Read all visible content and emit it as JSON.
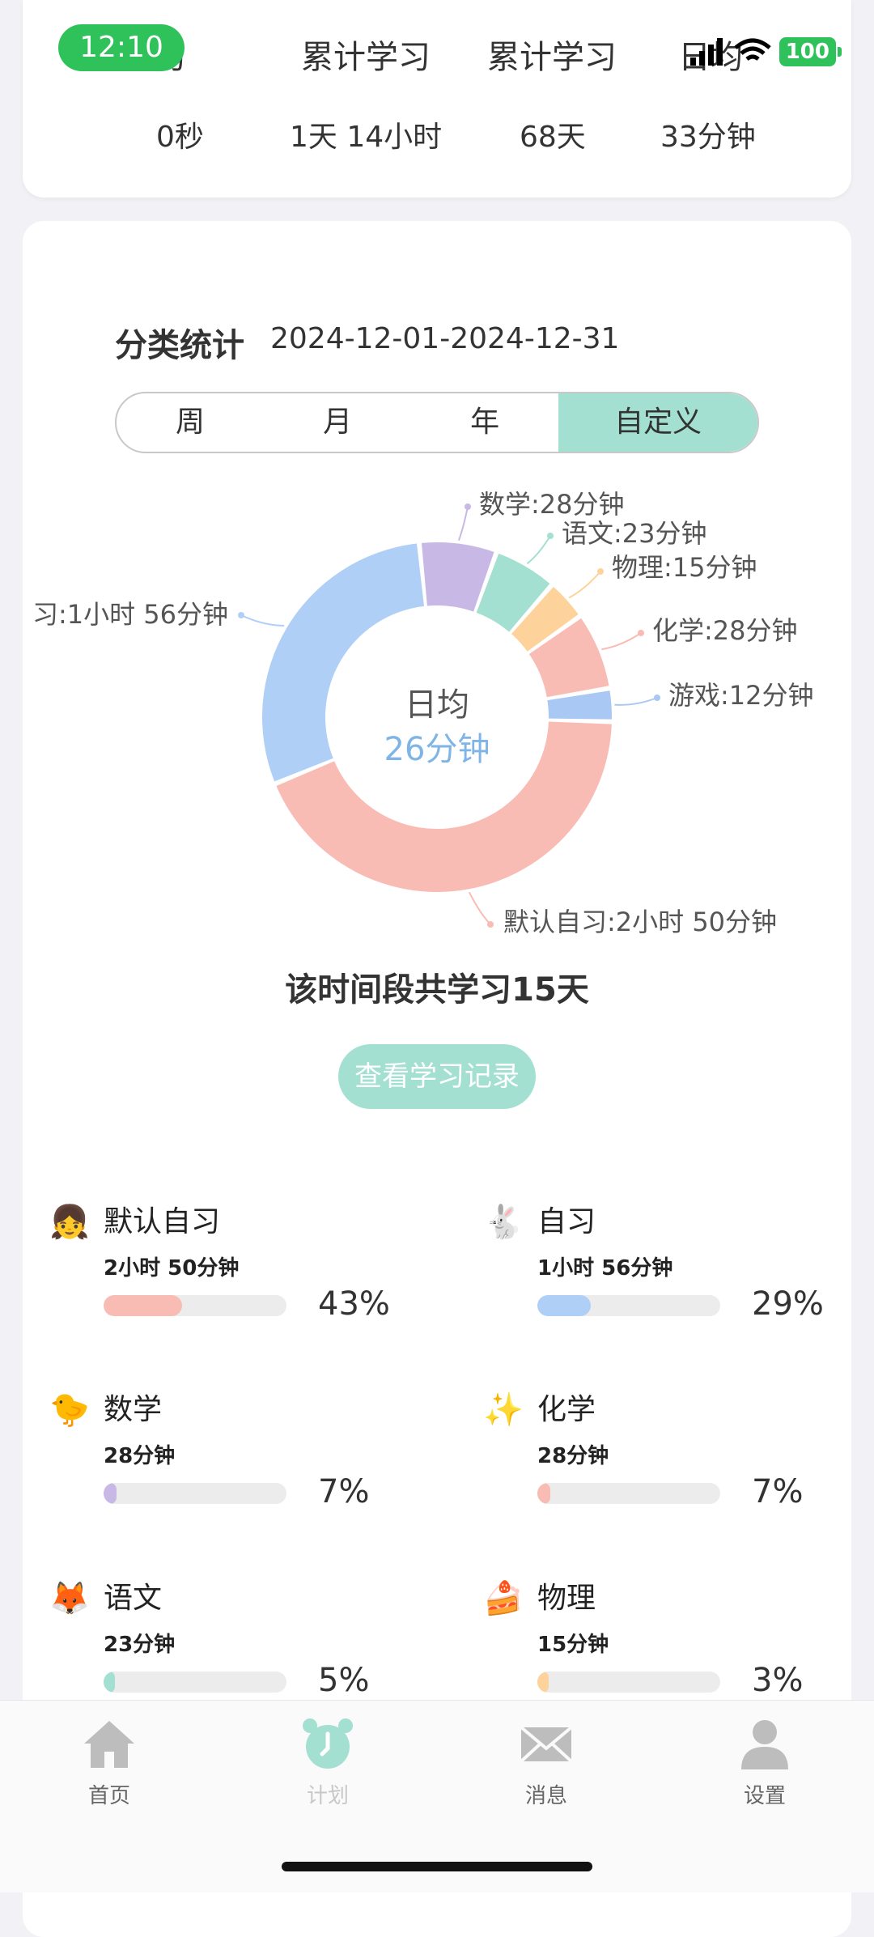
{
  "status": {
    "time": "12:10",
    "battery": "100"
  },
  "summary": [
    {
      "label": "学习",
      "value": "0秒"
    },
    {
      "label": "累计学习",
      "value": "1天 14小时"
    },
    {
      "label": "累计学习",
      "value": "68天"
    },
    {
      "label": "日均",
      "value": "33分钟"
    }
  ],
  "category_stats": {
    "title": "分类统计",
    "date_range": "2024-12-01-2024-12-31",
    "tabs": [
      "周",
      "月",
      "年",
      "自定义"
    ],
    "active_tab": "自定义",
    "center_label": "日均",
    "center_value": "26分钟",
    "total_days_text": "该时间段共学习15天",
    "records_button": "查看学习记录"
  },
  "chart_data": {
    "type": "pie",
    "categories": [
      "默认自习",
      "自习",
      "数学",
      "语文",
      "物理",
      "化学",
      "游戏"
    ],
    "values": [
      170,
      116,
      28,
      23,
      15,
      28,
      12
    ],
    "unit": "分钟",
    "labels": [
      "默认自习:2小时 50分钟",
      "习:1小时 56分钟",
      "数学:28分钟",
      "语文:23分钟",
      "物理:15分钟",
      "化学:28分钟",
      "游戏:12分钟"
    ],
    "colors": [
      "#f9bcb4",
      "#b0cff6",
      "#c8b8e6",
      "#a4e0d2",
      "#fdd39b",
      "#f9bcb4",
      "#a9c8f4"
    ]
  },
  "categories": [
    {
      "name": "默认自习",
      "duration": "2小时 50分钟",
      "percent": "43%",
      "fraction": 0.43,
      "color": "#f9bcb4",
      "icon": "girl-avatar-icon",
      "glyph": "👧"
    },
    {
      "name": "自习",
      "duration": "1小时 56分钟",
      "percent": "29%",
      "fraction": 0.29,
      "color": "#b0cff6",
      "icon": "rabbit-icon",
      "glyph": "🐇"
    },
    {
      "name": "数学",
      "duration": "28分钟",
      "percent": "7%",
      "fraction": 0.07,
      "color": "#c8b8e6",
      "icon": "bird-icon",
      "glyph": "🐤"
    },
    {
      "name": "化学",
      "duration": "28分钟",
      "percent": "7%",
      "fraction": 0.07,
      "color": "#f9bcb4",
      "icon": "sparkle-icon",
      "glyph": "✨"
    },
    {
      "name": "语文",
      "duration": "23分钟",
      "percent": "5%",
      "fraction": 0.05,
      "color": "#a4e0d2",
      "icon": "fox-icon",
      "glyph": "🦊"
    },
    {
      "name": "物理",
      "duration": "15分钟",
      "percent": "3%",
      "fraction": 0.03,
      "color": "#fdd39b",
      "icon": "cake-icon",
      "glyph": "🍰"
    }
  ],
  "nav": [
    {
      "label": "首页",
      "icon": "home-icon"
    },
    {
      "label": "计划",
      "icon": "alarm-clock-icon"
    },
    {
      "label": "消息",
      "icon": "mail-icon"
    },
    {
      "label": "设置",
      "icon": "person-icon"
    }
  ]
}
